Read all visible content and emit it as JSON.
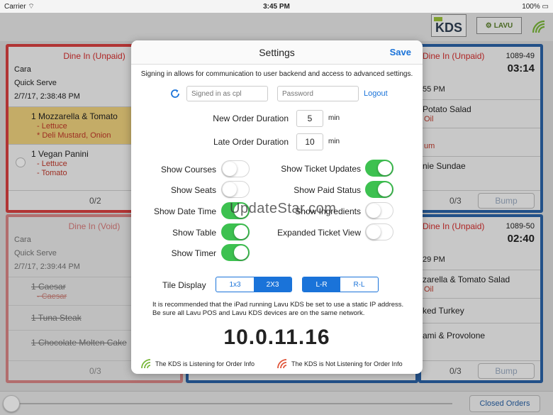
{
  "status_bar": {
    "carrier": "Carrier",
    "time": "3:45 PM",
    "battery": "100%"
  },
  "header": {
    "logo_kds": "KDS",
    "logo_lavu": "LAVU"
  },
  "tickets": [
    {
      "status": "Dine In (Unpaid)",
      "customer": "Cara",
      "type": "Quick Serve",
      "time": "2/7/17, 2:38:48 PM",
      "items": [
        {
          "name": "1 Mozzarella & Tomato",
          "mods": [
            "- Lettuce",
            "* Deli Mustard, Onion"
          ],
          "highlight": true
        },
        {
          "name": "1 Vegan Panini",
          "mods": [
            "- Lettuce",
            "- Tomato"
          ],
          "highlight": false
        }
      ],
      "count": "0/2"
    },
    {
      "status": "Dine In (Void)",
      "customer": "Cara",
      "type": "Quick Serve",
      "time": "2/7/17, 2:39:44 PM",
      "items": [
        {
          "name": "1 Caesar",
          "mods": [
            "- Caesar"
          ]
        },
        {
          "name": "1 Tuna Steak",
          "mods": []
        },
        {
          "name": "1 Chocolate Molten Cake",
          "mods": []
        }
      ],
      "count": "0/3"
    },
    {
      "status": "Dine In (Unpaid)",
      "number": "1089-49",
      "elapsed": "03:14",
      "time": "55 PM",
      "items": [
        {
          "name": "Potato Salad",
          "mods": [
            "Oil"
          ]
        },
        {
          "name": "",
          "mods": [
            "um"
          ]
        },
        {
          "name": "nie Sundae",
          "mods": []
        }
      ],
      "count": "0/3",
      "bump": "Bump"
    },
    {
      "status": "Dine In (Unpaid)",
      "number": "1089-50",
      "elapsed": "02:40",
      "time": "29 PM",
      "items": [
        {
          "name": "zarella & Tomato Salad",
          "mods": [
            "Oil"
          ]
        },
        {
          "name": "ked Turkey",
          "mods": []
        },
        {
          "name": "ami & Provolone",
          "mods": []
        }
      ],
      "count": "0/3",
      "bump": "Bump"
    }
  ],
  "partial_count": "0/3",
  "bottom": {
    "closed_orders": "Closed Orders"
  },
  "settings": {
    "title": "Settings",
    "save": "Save",
    "info": "Signing in allows for communication to user backend and access to advanced settings.",
    "username_placeholder": "Signed in as cpl",
    "password_placeholder": "Password",
    "logout": "Logout",
    "new_order_label": "New Order Duration",
    "new_order_value": "5",
    "late_order_label": "Late Order Duration",
    "late_order_value": "10",
    "unit": "min",
    "toggles_left": [
      {
        "label": "Show Courses",
        "on": false
      },
      {
        "label": "Show Seats",
        "on": false
      },
      {
        "label": "Show Date Time",
        "on": true
      },
      {
        "label": "Show Table",
        "on": true
      },
      {
        "label": "Show Timer",
        "on": true
      }
    ],
    "toggles_right": [
      {
        "label": "Show Ticket Updates",
        "on": true
      },
      {
        "label": "Show Paid Status",
        "on": true
      },
      {
        "label": "Show Ingredients",
        "on": false
      },
      {
        "label": "Expanded Ticket View",
        "on": false
      }
    ],
    "tile_display_label": "Tile Display",
    "tile_options": [
      "1x3",
      "2X3"
    ],
    "tile_selected": "2X3",
    "direction_options": [
      "L-R",
      "R-L"
    ],
    "direction_selected": "L-R",
    "recommendation": "It is recommended that the iPad running Lavu KDS be set to use a static IP address. Be sure all Lavu POS and Lavu KDS devices are on the same network.",
    "ip_address": "10.0.11.16",
    "listening": "The KDS is Listening for Order Info",
    "not_listening": "The KDS is Not Listening for Order Info"
  },
  "watermark": "UpdateStar.com",
  "colors": {
    "accent": "#1a73d9",
    "toggle_on": "#3dc150",
    "ticket_red": "#d84040",
    "ticket_blue": "#2a62a6",
    "wifi_green": "#7ab83a",
    "wifi_red": "#e0553a"
  }
}
